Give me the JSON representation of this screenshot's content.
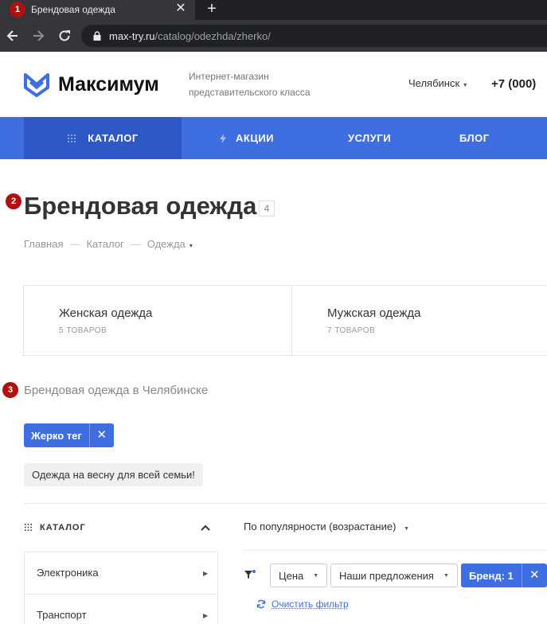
{
  "browser": {
    "tab_title": "Брендовая одежда",
    "tab_close": "✕",
    "new_tab": "+",
    "url_host": "max-try.ru",
    "url_path": "/catalog/odezhda/zherko/"
  },
  "badges": [
    "1",
    "2",
    "3"
  ],
  "header": {
    "brand": "Максимум",
    "tagline_line1": "Интернет-магазин",
    "tagline_line2": "представительского класса",
    "city": "Челябинск",
    "phone": "+7 (000)"
  },
  "menu": {
    "items": [
      {
        "label": "КАТАЛОГ",
        "icon": "grid-icon"
      },
      {
        "label": "АКЦИИ",
        "icon": "bolt-icon"
      },
      {
        "label": "УСЛУГИ"
      },
      {
        "label": "БЛОГ"
      }
    ]
  },
  "page": {
    "title": "Брендовая одежда",
    "count": "4",
    "breadcrumbs": [
      "Главная",
      "Каталог",
      "Одежда"
    ],
    "breadcrumb_sep": "—"
  },
  "categories": [
    {
      "name": "Женская одежда",
      "count": "5 ТОВАРОВ"
    },
    {
      "name": "Мужская одежда",
      "count": "7 ТОВАРОВ"
    }
  ],
  "subtitle": "Брендовая одежда в Челябинске",
  "active_tag": {
    "label": "Жерко тег",
    "remove": "✕"
  },
  "chip": "Одежда на весну для всей семьи!",
  "sidebar": {
    "heading": "КАТАЛОГ",
    "items": [
      {
        "label": "Электроника"
      },
      {
        "label": "Транспорт"
      }
    ]
  },
  "sort": {
    "label": "По популярности (возрастание)"
  },
  "filters": {
    "price": "Цена",
    "offers": "Наши предложения",
    "brand": "Бренд: 1",
    "brand_remove": "✕",
    "clear": "Очистить фильтр"
  },
  "colors": {
    "accent": "#3f6ee0",
    "accent_dark": "#2e58c6",
    "badge": "#b20f0f"
  }
}
